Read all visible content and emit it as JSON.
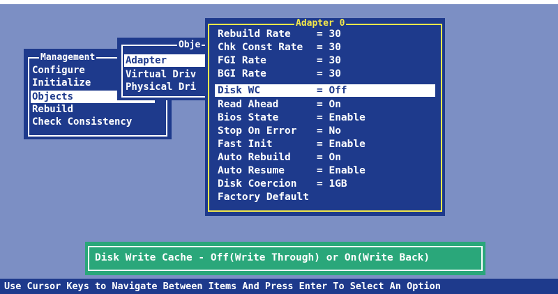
{
  "management": {
    "title": "Management",
    "items": [
      {
        "label": "Configure"
      },
      {
        "label": "Initialize"
      },
      {
        "label": "Objects"
      },
      {
        "label": "Rebuild"
      },
      {
        "label": "Check Consistency"
      }
    ],
    "selected_index": 2
  },
  "objects": {
    "title": "Obje",
    "items": [
      {
        "label": "Adapter "
      },
      {
        "label": "Virtual Driv"
      },
      {
        "label": "Physical Dri"
      }
    ],
    "selected_index": 0
  },
  "adapter": {
    "title": "Adapter 0",
    "rows": [
      {
        "name": "Rebuild Rate",
        "value": "= 30"
      },
      {
        "name": "Chk Const Rate",
        "value": "= 30"
      },
      {
        "name": "FGI Rate",
        "value": "= 30"
      },
      {
        "name": "BGI Rate",
        "value": "= 30"
      },
      {
        "name": "Disk WC",
        "value": "= Off"
      },
      {
        "name": "Read Ahead",
        "value": "= On"
      },
      {
        "name": "Bios State",
        "value": "= Enable"
      },
      {
        "name": "Stop On Error",
        "value": "= No"
      },
      {
        "name": "Fast Init",
        "value": "= Enable"
      },
      {
        "name": "Auto Rebuild",
        "value": "= On"
      },
      {
        "name": "Auto Resume",
        "value": "= Enable"
      },
      {
        "name": "Disk Coercion",
        "value": "= 1GB"
      },
      {
        "name": "Factory Default",
        "value": ""
      }
    ],
    "selected_index": 4
  },
  "hint": "Disk Write Cache - Off(Write Through) or On(Write Back)",
  "status": "Use Cursor Keys to Navigate Between Items And Press Enter To Select An Option",
  "colors": {
    "background": "#7c8fc4",
    "window": "#1e3a8c",
    "hint_box": "#2aa77a",
    "active_border": "#f4e84a"
  }
}
